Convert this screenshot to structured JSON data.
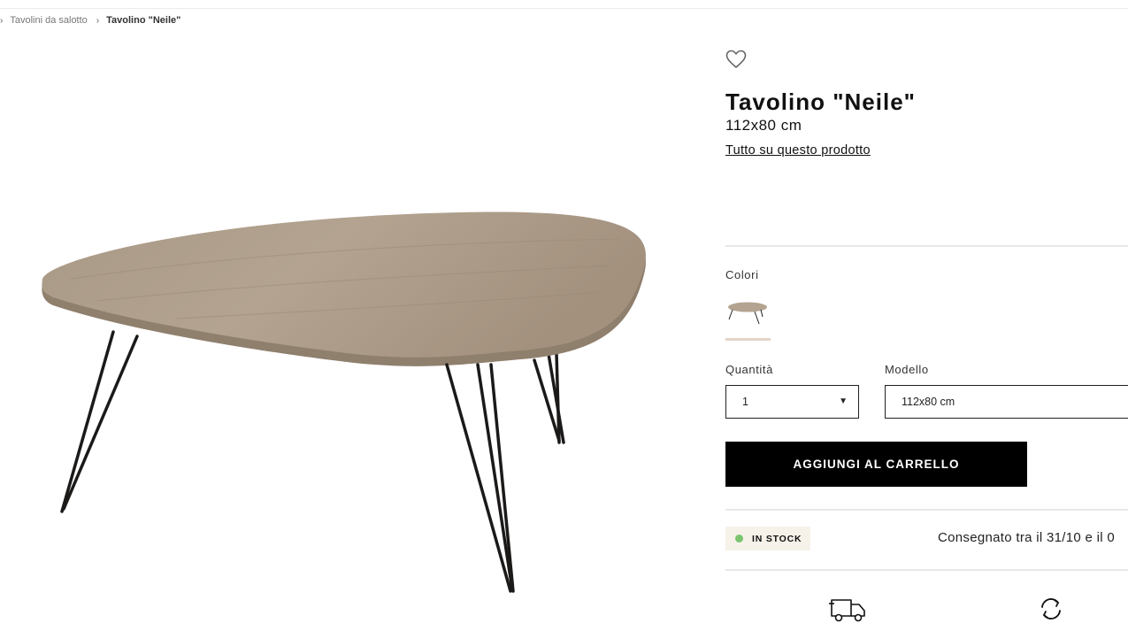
{
  "breadcrumb": {
    "items": [
      {
        "label": "Tavolini da salotto"
      },
      {
        "label": "Tavolino \"Neile\""
      }
    ]
  },
  "product": {
    "title": "Tavolino \"Neile\"",
    "size": "112x80 cm",
    "about_link": "Tutto su questo prodotto",
    "image_icon": "coffee-table-image"
  },
  "options": {
    "colors_label": "Colori",
    "quantity_label": "Quantità",
    "quantity_value": "1",
    "model_label": "Modello",
    "model_value": "112x80 cm"
  },
  "cart": {
    "button_label": "AGGIUNGI AL CARRELLO"
  },
  "availability": {
    "badge": "IN STOCK",
    "badge_color": "#7ac46e",
    "delivery_text": "Consegnato tra il 31/10 e il 0"
  },
  "icons": {
    "wishlist": "heart-icon",
    "shipping": "truck-icon",
    "returns": "refresh-icon"
  }
}
